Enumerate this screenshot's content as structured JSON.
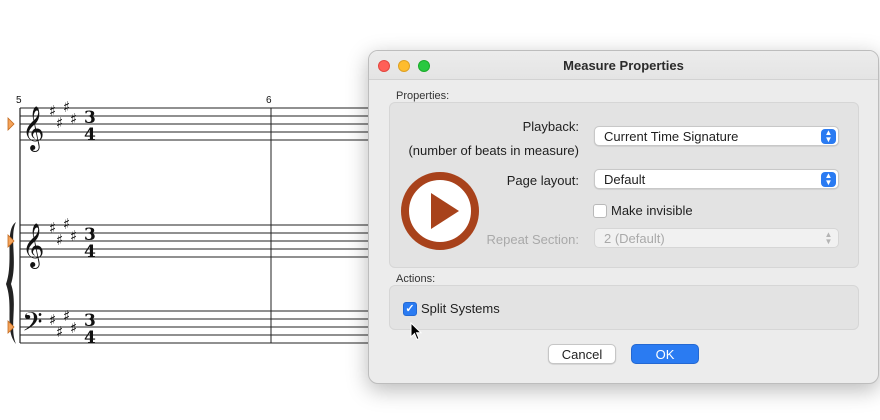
{
  "score": {
    "measure_numbers": [
      "5",
      "6"
    ],
    "time_signature": {
      "top": "3",
      "bottom": "4"
    }
  },
  "dialog": {
    "title": "Measure Properties",
    "properties_label": "Properties:",
    "playback": {
      "label": "Playback:",
      "sublabel": "(number of beats in measure)",
      "value": "Current Time Signature"
    },
    "page_layout": {
      "label": "Page layout:",
      "value": "Default"
    },
    "make_invisible": {
      "label": "Make invisible",
      "checked": false
    },
    "repeat_section": {
      "label": "Repeat Section:",
      "value": "2 (Default)",
      "enabled": false
    },
    "actions_label": "Actions:",
    "split_systems": {
      "label": "Split Systems",
      "checked": true
    },
    "buttons": {
      "cancel": "Cancel",
      "ok": "OK"
    }
  },
  "overlay": {
    "play_icon": "play-icon",
    "play_color": "#a8421b",
    "accent": "#2a7bf2"
  }
}
